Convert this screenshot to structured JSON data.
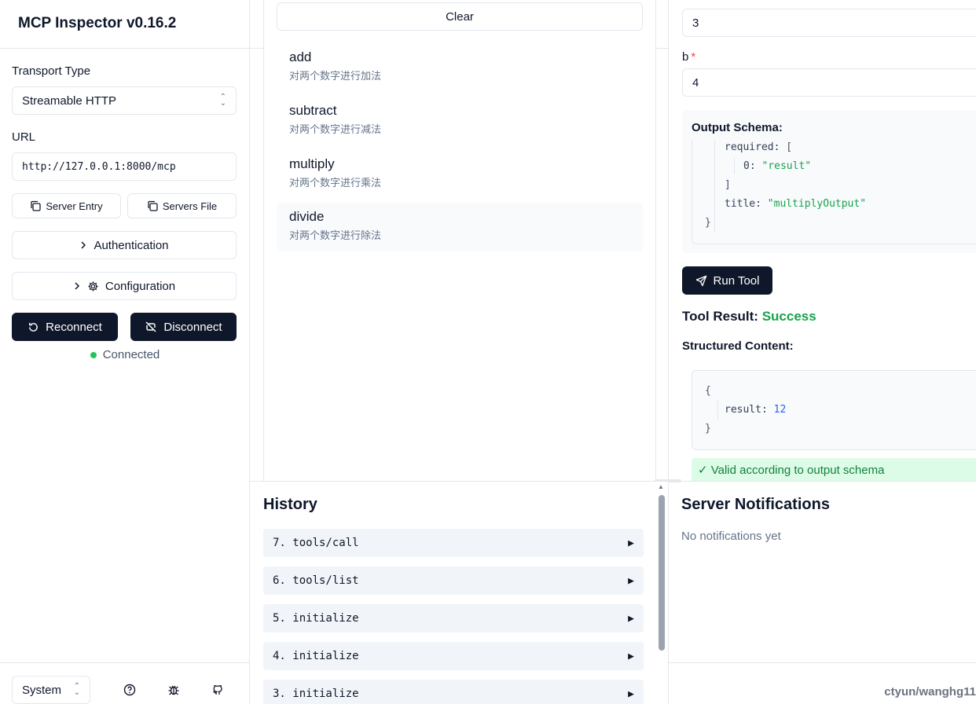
{
  "sidebar": {
    "title": "MCP Inspector v0.16.2",
    "transport_label": "Transport Type",
    "transport_value": "Streamable HTTP",
    "url_label": "URL",
    "url_value": "http://127.0.0.1:8000/mcp",
    "server_entry_label": "Server Entry",
    "servers_file_label": "Servers File",
    "authentication_label": "Authentication",
    "configuration_label": "Configuration",
    "reconnect_label": "Reconnect",
    "disconnect_label": "Disconnect",
    "status_text": "Connected",
    "theme_value": "System"
  },
  "tools": {
    "clear_label": "Clear",
    "items": [
      {
        "name": "add",
        "desc": "对两个数字进行加法"
      },
      {
        "name": "subtract",
        "desc": "对两个数字进行减法"
      },
      {
        "name": "multiply",
        "desc": "对两个数字进行乘法"
      },
      {
        "name": "divide",
        "desc": "对两个数字进行除法"
      }
    ]
  },
  "detail": {
    "a_value": "3",
    "b_label": "b",
    "b_required": "*",
    "b_value": "4",
    "output_schema_title": "Output Schema:",
    "schema_required_key": "required:",
    "schema_bracket_open": "[",
    "schema_item_key": "0:",
    "schema_item_value": "\"result\"",
    "schema_bracket_close": "]",
    "schema_title_key": "title:",
    "schema_title_value": "\"multiplyOutput\"",
    "schema_brace_close": "}",
    "run_label": "Run Tool",
    "result_label": "Tool Result:",
    "result_status": "Success",
    "structured_title": "Structured Content:",
    "struct_brace_open": "{",
    "struct_key": "result:",
    "struct_value": "12",
    "struct_brace_close": "}",
    "valid_text": "✓ Valid according to output schema"
  },
  "history": {
    "title": "History",
    "items": [
      "7. tools/call",
      "6. tools/list",
      "5. initialize",
      "4. initialize",
      "3. initialize"
    ]
  },
  "notifications": {
    "title": "Server Notifications",
    "empty": "No notifications yet"
  },
  "watermark": "ctyun/wanghg11"
}
